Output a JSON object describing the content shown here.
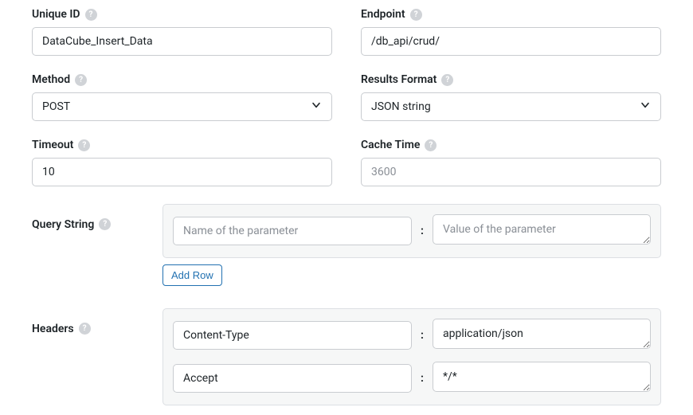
{
  "labels": {
    "unique_id": "Unique ID",
    "endpoint": "Endpoint",
    "method": "Method",
    "results_format": "Results Format",
    "timeout": "Timeout",
    "cache_time": "Cache Time",
    "query_string": "Query String",
    "headers": "Headers"
  },
  "values": {
    "unique_id": "DataCube_Insert_Data",
    "endpoint": "/db_api/crud/",
    "method": "POST",
    "results_format": "JSON string",
    "timeout": "10",
    "cache_time_placeholder": "3600"
  },
  "placeholders": {
    "param_name": "Name of the parameter",
    "param_value": "Value of the parameter"
  },
  "buttons": {
    "add_row": "Add Row"
  },
  "headers_rows": [
    {
      "name": "Content-Type",
      "value": "application/json"
    },
    {
      "name": "Accept",
      "value": "*/*"
    }
  ],
  "help_glyph": "?",
  "colon": ":"
}
